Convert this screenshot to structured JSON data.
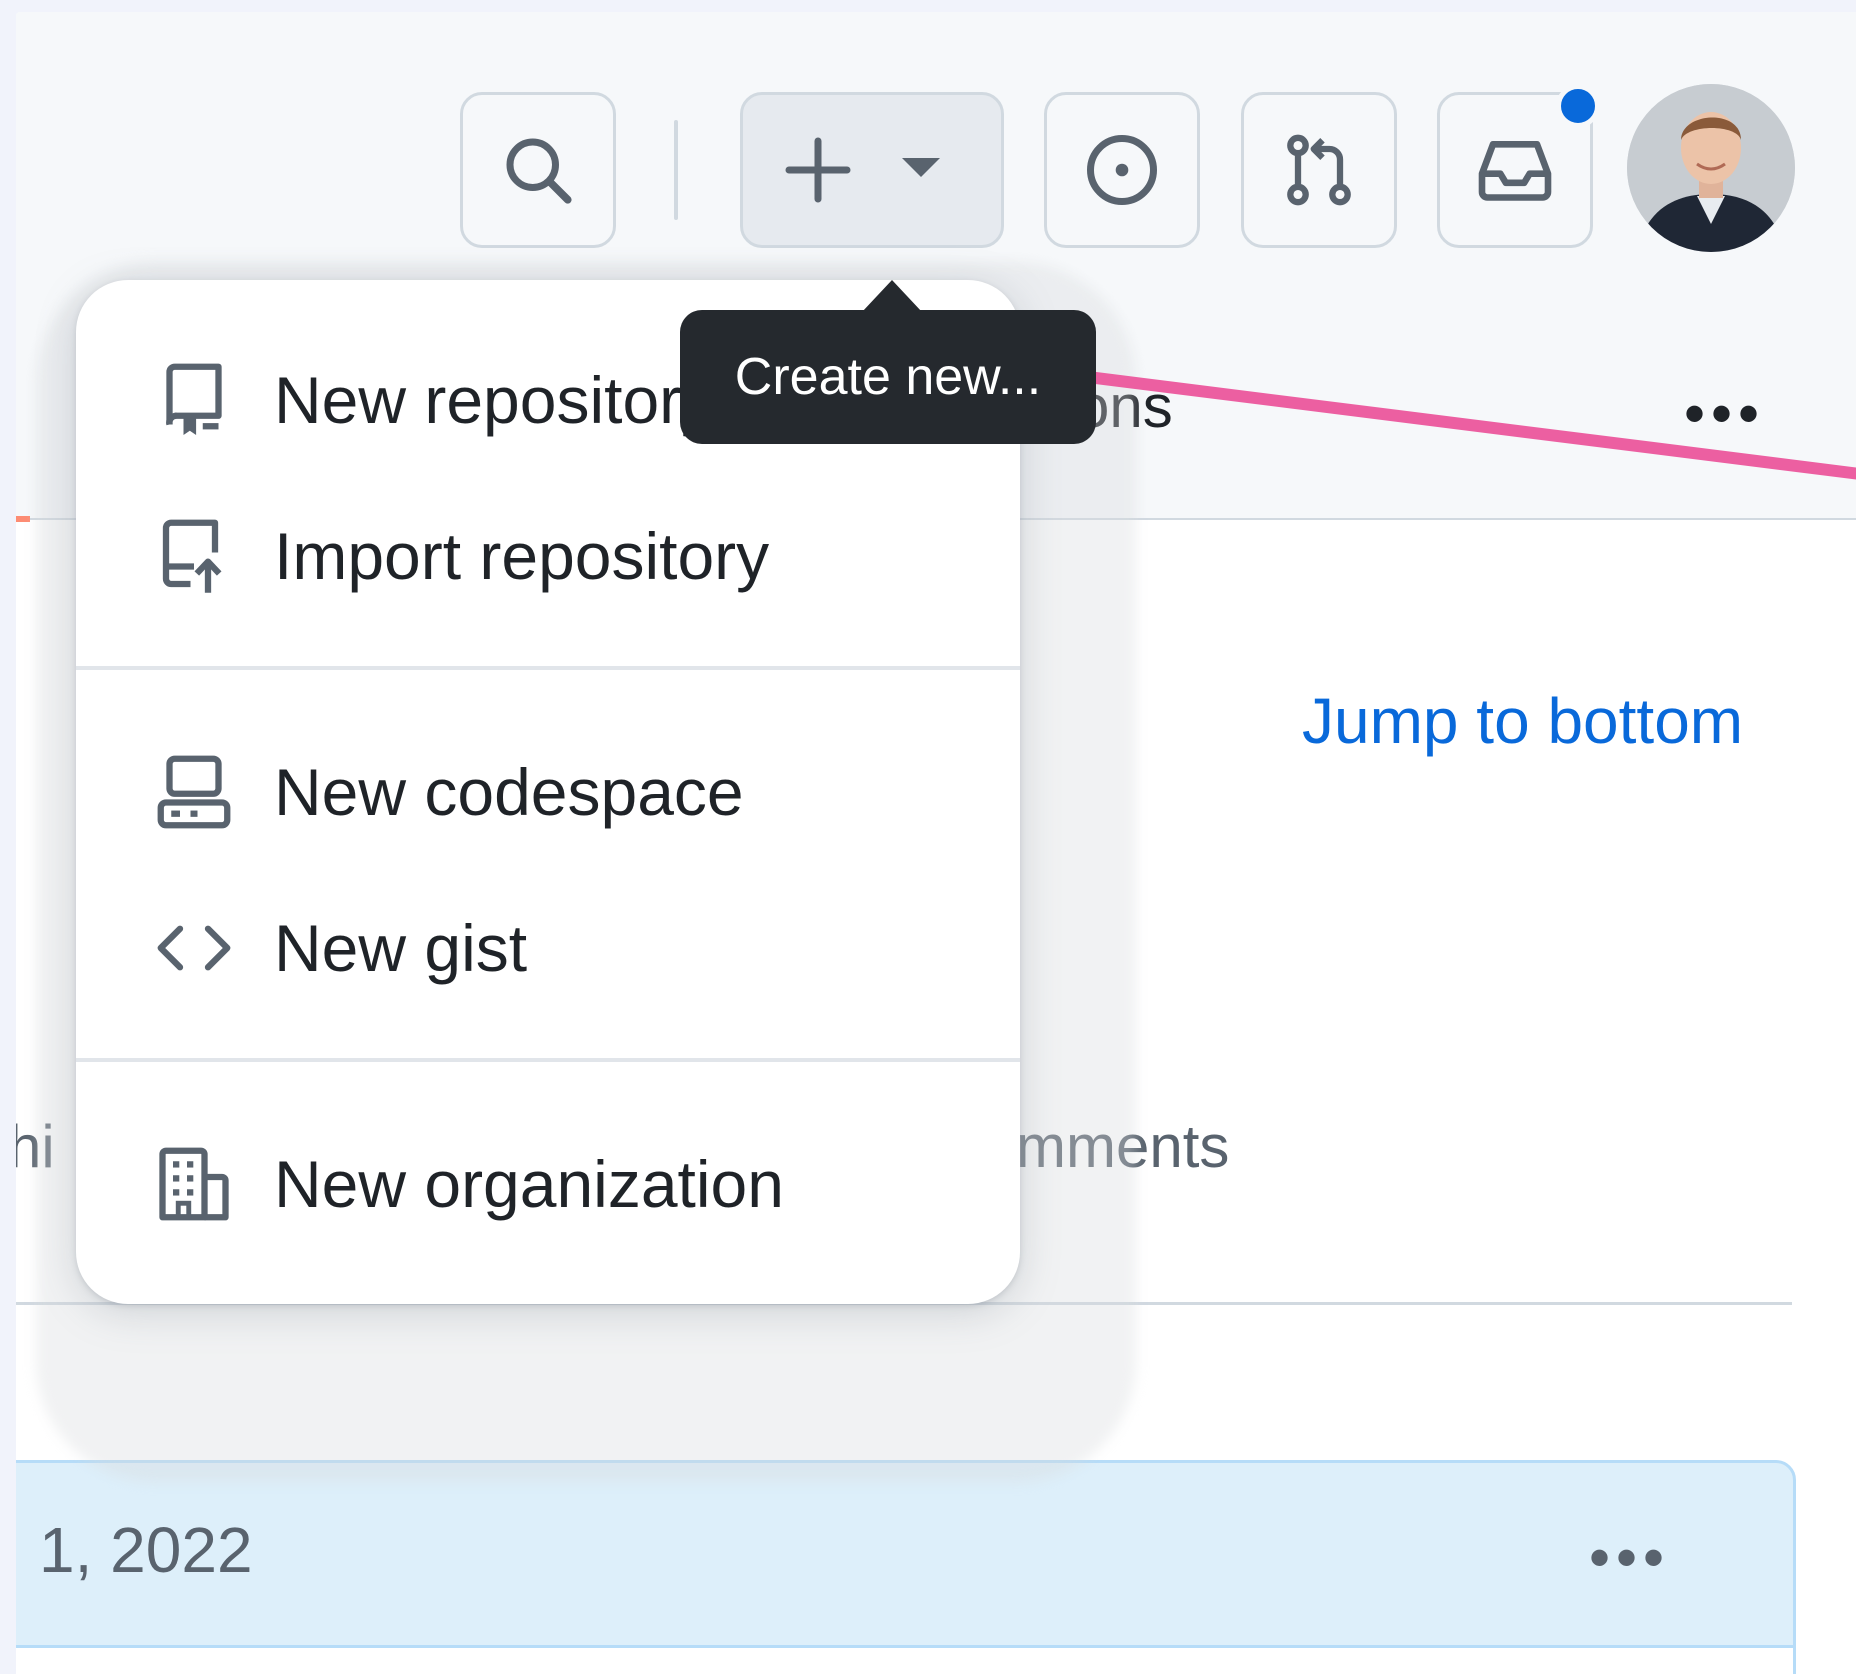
{
  "header": {
    "tab_partial": "ctions",
    "more_label": "•••"
  },
  "create_button": {
    "plus": "+",
    "tooltip": "Create new..."
  },
  "menu": {
    "items": [
      {
        "label": "New repository",
        "icon": "repo-icon"
      },
      {
        "label": "Import repository",
        "icon": "repo-push-icon"
      },
      {
        "label": "New codespace",
        "icon": "codespaces-icon"
      },
      {
        "label": "New gist",
        "icon": "code-icon"
      },
      {
        "label": "New organization",
        "icon": "organization-icon"
      }
    ]
  },
  "content": {
    "jump_link": "Jump to bottom",
    "partial_left": "hi",
    "partial_comments": "mments",
    "date_text": "1, 2022",
    "date_more": "•••"
  },
  "colors": {
    "accent": "#0969da",
    "annotation_arrow": "#ec5fa1",
    "tooltip_bg": "#25292e"
  }
}
